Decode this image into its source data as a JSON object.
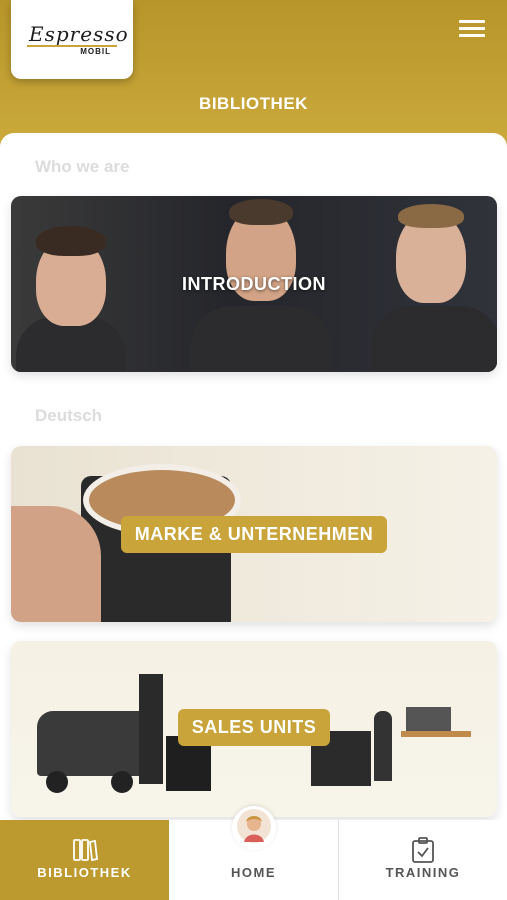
{
  "header": {
    "title": "BIBLIOTHEK",
    "logo_text": "Espresso",
    "logo_sub": "MOBIL"
  },
  "sections": [
    {
      "label": "Who we are"
    },
    {
      "label": "Deutsch"
    }
  ],
  "cards": [
    {
      "label": "INTRODUCTION"
    },
    {
      "label": "MARKE & UNTERNEHMEN"
    },
    {
      "label": "SALES UNITS"
    }
  ],
  "tabs": [
    {
      "label": "BIBLIOTHEK",
      "icon": "books-icon",
      "active": true
    },
    {
      "label": "HOME",
      "icon": "avatar-icon",
      "active": false
    },
    {
      "label": "TRAINING",
      "icon": "clipboard-check-icon",
      "active": false
    }
  ],
  "colors": {
    "accent": "#bd9a2f",
    "header": "#c5a336"
  }
}
